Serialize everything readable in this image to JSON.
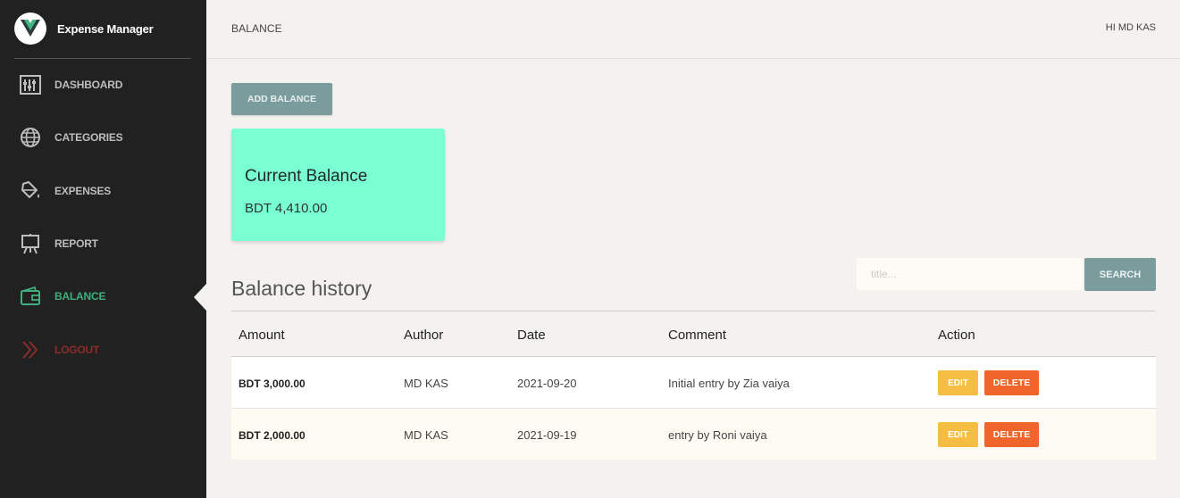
{
  "app": {
    "name": "Expense Manager",
    "logo_icon": "vue-logo-icon"
  },
  "sidebar": {
    "items": [
      {
        "label": "DASHBOARD",
        "icon": "dashboard-icon",
        "active": false
      },
      {
        "label": "CATEGORIES",
        "icon": "globe-icon",
        "active": false
      },
      {
        "label": "EXPENSES",
        "icon": "paint-bucket-icon",
        "active": false
      },
      {
        "label": "REPORT",
        "icon": "easel-icon",
        "active": false
      },
      {
        "label": "BALANCE",
        "icon": "wallet-icon",
        "active": true
      },
      {
        "label": "LOGOUT",
        "icon": "double-chevron-right-icon",
        "active": false
      }
    ]
  },
  "header": {
    "title": "BALANCE",
    "greeting": "HI MD KAS"
  },
  "main": {
    "add_button": "ADD BALANCE",
    "balance_card": {
      "title": "Current Balance",
      "value": "BDT 4,410.00"
    },
    "history_title": "Balance history",
    "search": {
      "placeholder": "title...",
      "button": "SEARCH"
    },
    "table": {
      "columns": [
        "Amount",
        "Author",
        "Date",
        "Comment",
        "Action"
      ],
      "rows": [
        {
          "amount": "BDT 3,000.00",
          "author": "MD KAS",
          "date": "2021-09-20",
          "comment": "Initial entry by Zia vaiya",
          "edit": "EDIT",
          "delete": "DELETE"
        },
        {
          "amount": "BDT 2,000.00",
          "author": "MD KAS",
          "date": "2021-09-19",
          "comment": "entry by Roni vaiya",
          "edit": "EDIT",
          "delete": "DELETE"
        }
      ]
    }
  },
  "colors": {
    "sidebar_bg": "#212121",
    "active": "#3fb07d",
    "logout": "#8e2b2b",
    "card_bg": "#79ffd1",
    "primary_button": "#7b9c9d",
    "edit_button": "#f5bd41",
    "delete_button": "#f0652a"
  }
}
